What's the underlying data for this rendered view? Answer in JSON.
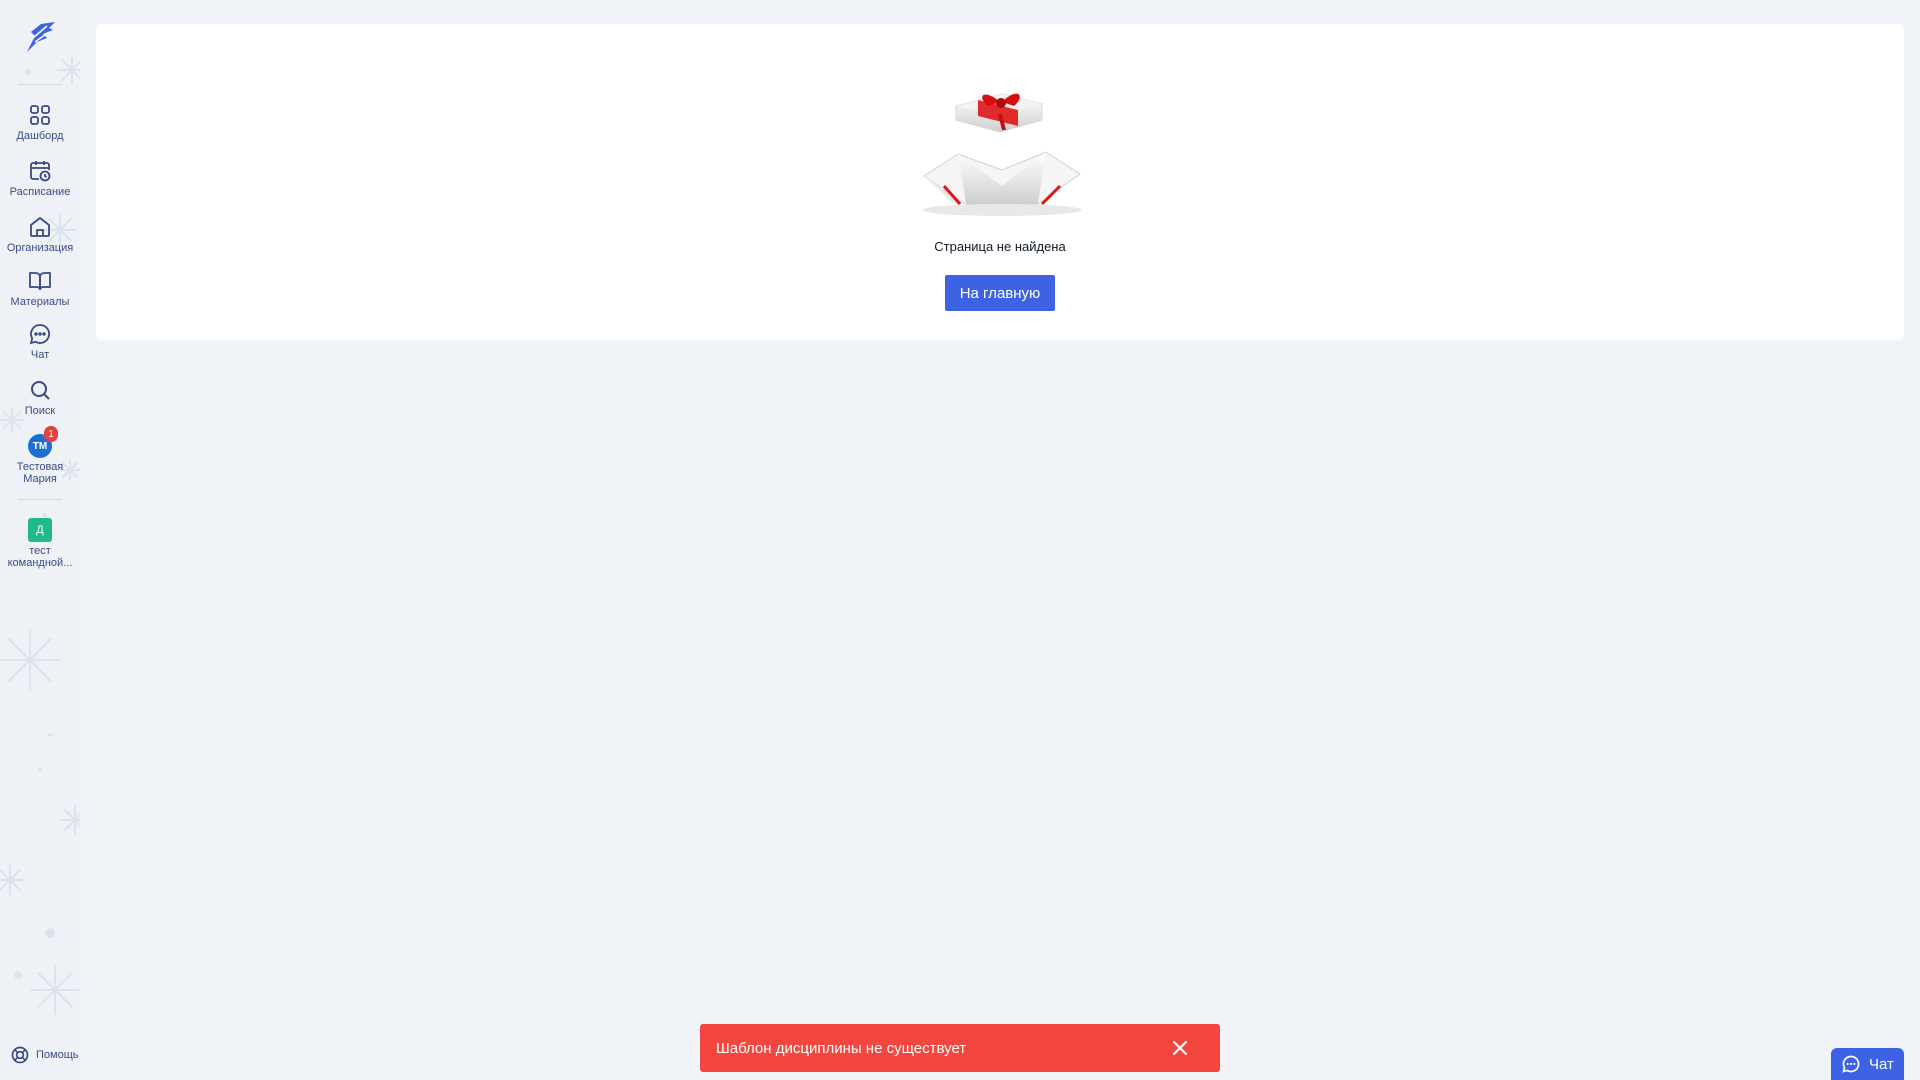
{
  "sidebar": {
    "items": [
      {
        "label": "Дашборд",
        "icon": "dashboard-grid-icon"
      },
      {
        "label": "Расписание",
        "icon": "calendar-clock-icon"
      },
      {
        "label": "Организация",
        "icon": "home-icon"
      },
      {
        "label": "Материалы",
        "icon": "book-icon"
      },
      {
        "label": "Чат",
        "icon": "chat-bubble-icon"
      },
      {
        "label": "Поиск",
        "icon": "search-icon"
      }
    ],
    "user": {
      "initials": "ТМ",
      "badge": "1",
      "name_line1": "Тестовая",
      "name_line2": "Мария"
    },
    "team": {
      "initial": "Д",
      "name_line1": "тест",
      "name_line2": "командной..."
    },
    "help_label": "Помощь"
  },
  "main": {
    "not_found_text": "Страница не найдена",
    "home_button": "На главную"
  },
  "toast": {
    "message": "Шаблон дисциплины не существует",
    "color": "#f2463e"
  },
  "chat_widget": {
    "label": "Чат"
  },
  "colors": {
    "accent": "#3d63e4",
    "sidebar_text": "#3b4a86",
    "background": "#eff3f7"
  }
}
